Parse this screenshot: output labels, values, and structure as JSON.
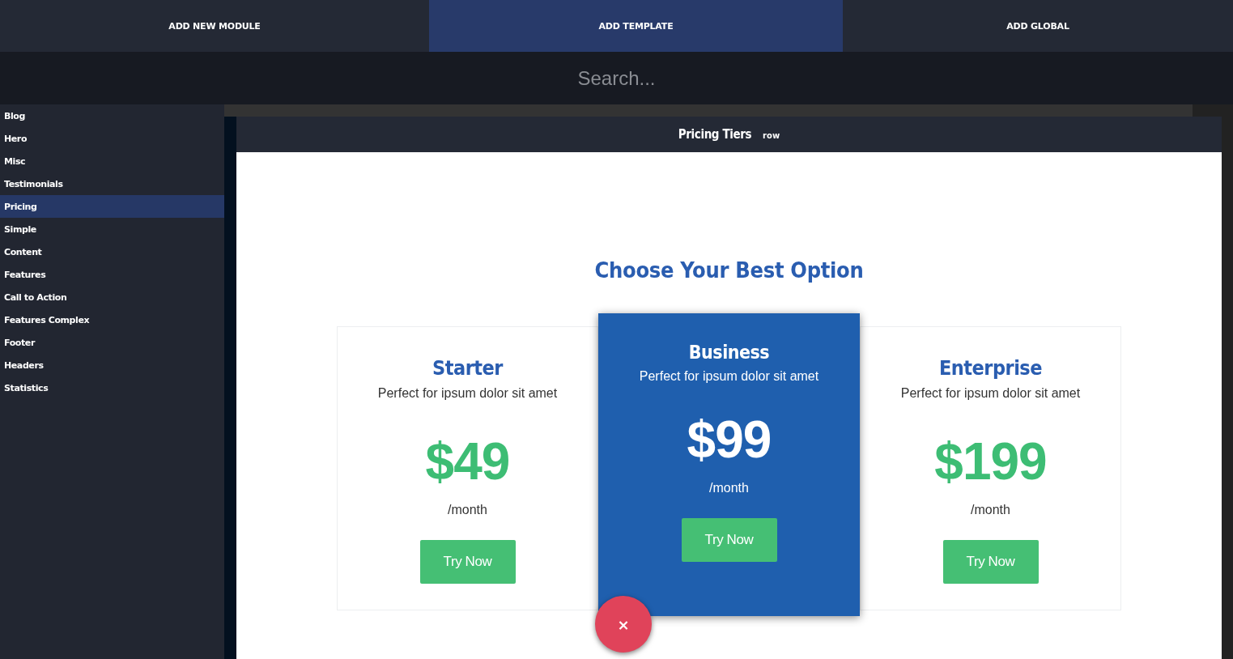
{
  "tabs": [
    {
      "label": "ADD NEW MODULE",
      "selected": false
    },
    {
      "label": "ADD TEMPLATE",
      "selected": true
    },
    {
      "label": "ADD GLOBAL",
      "selected": false
    }
  ],
  "search": {
    "placeholder": "Search..."
  },
  "sidebar": {
    "items": [
      {
        "label": "Blog",
        "selected": false
      },
      {
        "label": "Hero",
        "selected": false
      },
      {
        "label": "Misc",
        "selected": false
      },
      {
        "label": "Testimonials",
        "selected": false
      },
      {
        "label": "Pricing",
        "selected": true
      },
      {
        "label": "Simple",
        "selected": false
      },
      {
        "label": "Content",
        "selected": false
      },
      {
        "label": "Features",
        "selected": false
      },
      {
        "label": "Call to Action",
        "selected": false
      },
      {
        "label": "Features Complex",
        "selected": false
      },
      {
        "label": "Footer",
        "selected": false
      },
      {
        "label": "Headers",
        "selected": false
      },
      {
        "label": "Statistics",
        "selected": false
      }
    ]
  },
  "modal": {
    "title": "Pricing Tiers",
    "tag": "row",
    "heading": "Choose Your Best Option",
    "cards": [
      {
        "name": "Starter",
        "subtitle": "Perfect for ipsum dolor sit amet",
        "price": "$49",
        "period": "/month",
        "button": "Try Now",
        "featured": false
      },
      {
        "name": "Business",
        "subtitle": "Perfect for ipsum dolor sit amet",
        "price": "$99",
        "period": "/month",
        "button": "Try Now",
        "featured": true
      },
      {
        "name": "Enterprise",
        "subtitle": "Perfect for ipsum dolor sit amet",
        "price": "$199",
        "period": "/month",
        "button": "Try Now",
        "featured": false
      }
    ],
    "close": "×"
  }
}
